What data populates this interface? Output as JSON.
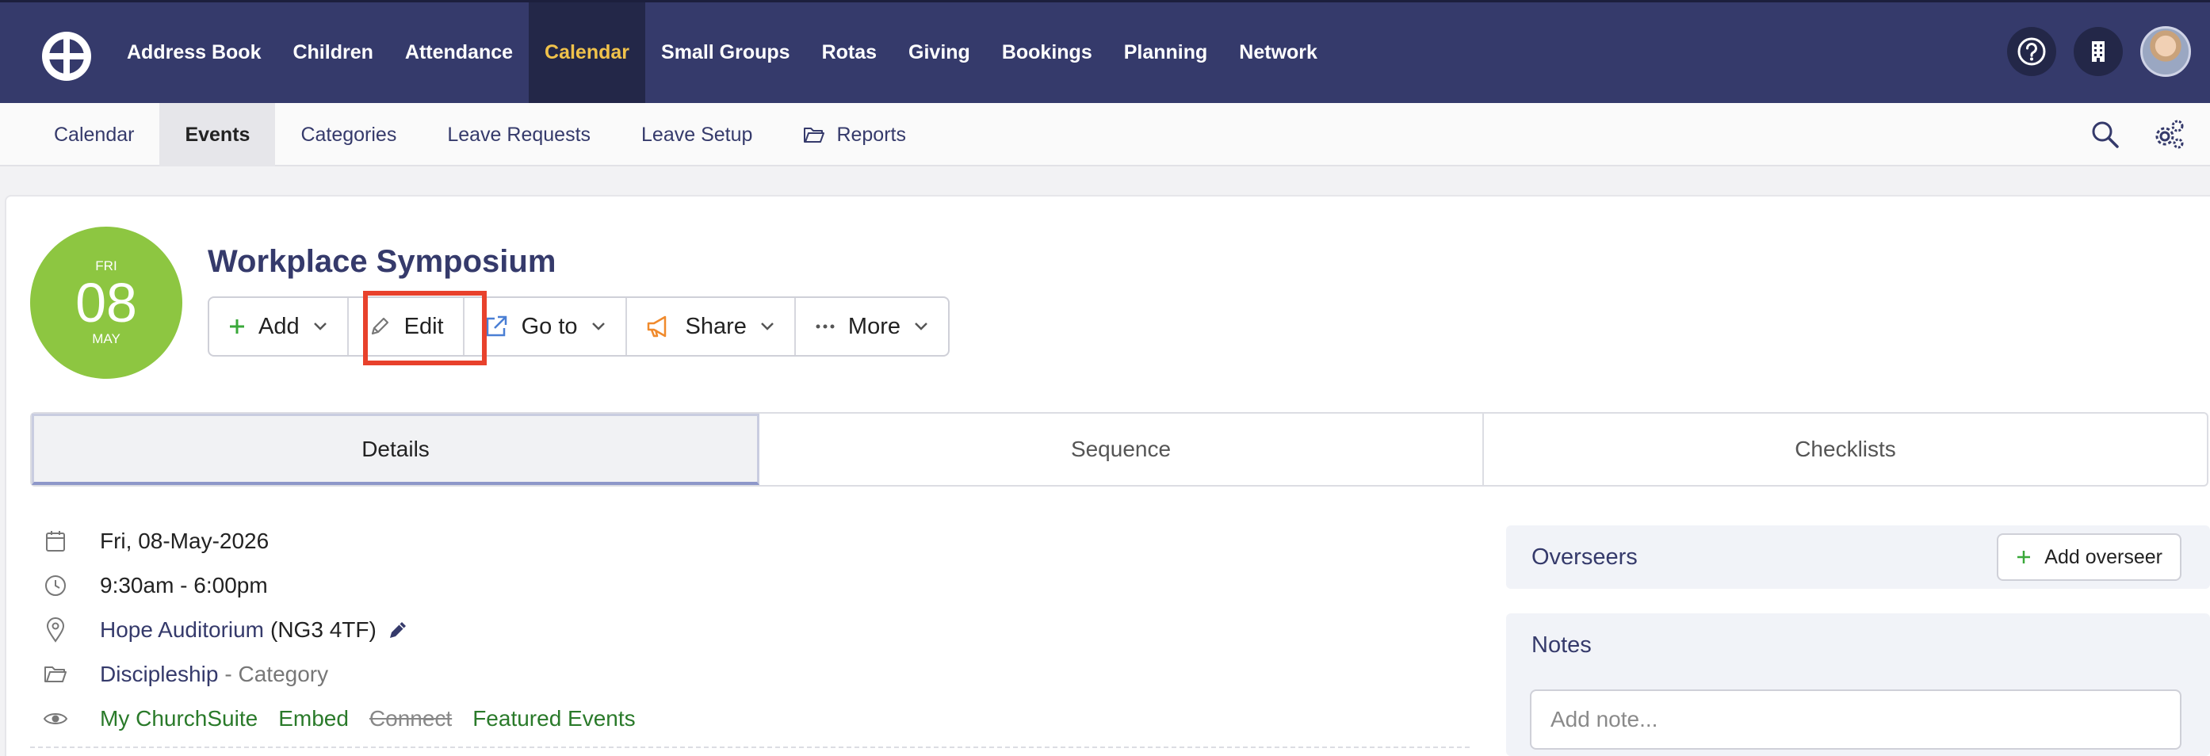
{
  "topnav": {
    "items": [
      "Address Book",
      "Children",
      "Attendance",
      "Calendar",
      "Small Groups",
      "Rotas",
      "Giving",
      "Bookings",
      "Planning",
      "Network"
    ],
    "active": "Calendar",
    "icons": [
      "help-icon",
      "building-icon",
      "avatar"
    ]
  },
  "subnav": {
    "items": [
      "Calendar",
      "Events",
      "Categories",
      "Leave Requests",
      "Leave Setup",
      "Reports"
    ],
    "active": "Events",
    "icons": [
      "search-icon",
      "settings-icon"
    ]
  },
  "event": {
    "dow": "FRI",
    "day": "08",
    "month": "MAY",
    "title": "Workplace Symposium"
  },
  "actions": {
    "add": "Add",
    "edit": "Edit",
    "goto": "Go to",
    "share": "Share",
    "more": "More"
  },
  "tabs": [
    "Details",
    "Sequence",
    "Checklists"
  ],
  "details": {
    "date": "Fri, 08-May-2026",
    "time": "9:30am - 6:00pm",
    "location_name": "Hope Auditorium",
    "location_postcode": "(NG3 4TF)",
    "category_name": "Discipleship",
    "category_suffix": "- Category",
    "visibility": [
      "My ChurchSuite",
      "Embed",
      "Connect",
      "Featured Events"
    ]
  },
  "overseers": {
    "title": "Overseers",
    "add_label": "Add overseer"
  },
  "notes": {
    "title": "Notes",
    "placeholder": "Add note..."
  },
  "colors": {
    "nav_bg": "#353a6b",
    "nav_active_text": "#f0c24b",
    "date_badge": "#8dc641",
    "highlight": "#e8412c",
    "link": "#353a6b",
    "visibility_link": "#2a7a2a"
  }
}
